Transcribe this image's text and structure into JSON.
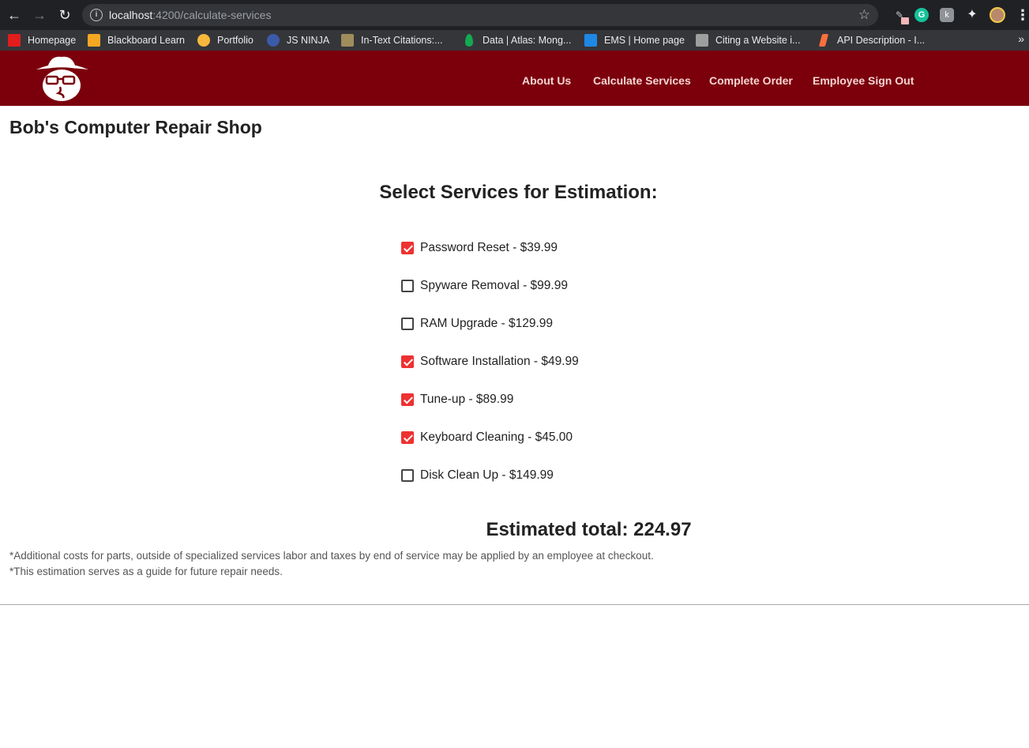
{
  "browser": {
    "url_host": "localhost",
    "url_path": ":4200/calculate-services",
    "bookmarks": [
      {
        "label": "Homepage",
        "icon": "oracle-icon",
        "color": "#e11d1d"
      },
      {
        "label": "Blackboard Learn",
        "icon": "blackboard-icon",
        "color": "#f5a623"
      },
      {
        "label": "Portfolio",
        "icon": "smiley-icon",
        "color": "#f6b73c"
      },
      {
        "label": "JS NINJA",
        "icon": "ninja-icon",
        "color": "#3b5ba9"
      },
      {
        "label": "In-Text Citations:...",
        "icon": "purdue-owl-icon",
        "color": "#a08d5c"
      },
      {
        "label": "Data | Atlas: Mong...",
        "icon": "mongodb-leaf-icon",
        "color": "#13aa52"
      },
      {
        "label": "EMS | Home page",
        "icon": "ems-icon",
        "color": "#1e88e5"
      },
      {
        "label": "Citing a Website i...",
        "icon": "citation-icon",
        "color": "#9e9e9e"
      },
      {
        "label": "API Description - I...",
        "icon": "lightning-icon",
        "color": "#ff6f3c"
      }
    ]
  },
  "header": {
    "nav": [
      "About Us",
      "Calculate Services",
      "Complete Order",
      "Employee Sign Out"
    ],
    "background": "#7b000c"
  },
  "page": {
    "shop_name": "Bob's Computer Repair Shop",
    "section_title": "Select Services for Estimation:",
    "services": [
      {
        "label": "Password Reset - $39.99",
        "checked": true
      },
      {
        "label": "Spyware Removal - $99.99",
        "checked": false
      },
      {
        "label": "RAM Upgrade - $129.99",
        "checked": false
      },
      {
        "label": "Software Installation - $49.99",
        "checked": true
      },
      {
        "label": "Tune-up - $89.99",
        "checked": true
      },
      {
        "label": "Keyboard Cleaning - $45.00",
        "checked": true
      },
      {
        "label": "Disk Clean Up - $149.99",
        "checked": false
      }
    ],
    "total_text": "Estimated total: 224.97",
    "notes": [
      "*Additional costs for parts, outside of specialized services labor and taxes by end of service may be applied by an employee at checkout.",
      "*This estimation serves as a guide for future repair needs."
    ],
    "checkbox_color": "#ee3131"
  }
}
